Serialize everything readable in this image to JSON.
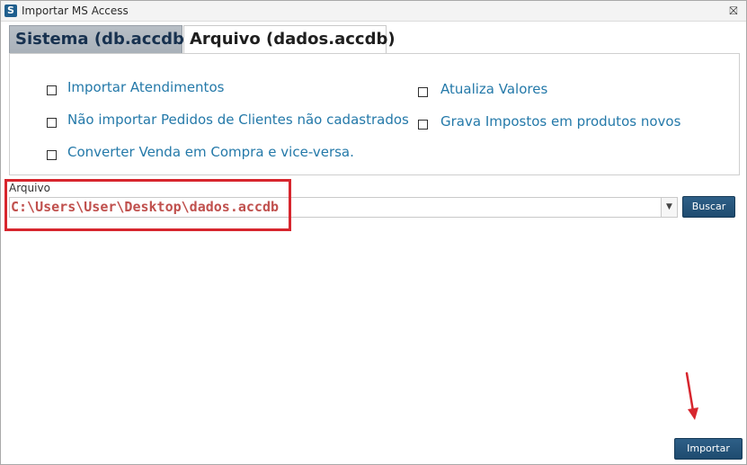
{
  "window": {
    "title": "Importar MS Access",
    "icon": "app-logo-icon",
    "close_icon": "close-icon",
    "close_glyph": "⛝"
  },
  "tabs": [
    {
      "label": "Sistema  (db.accdb)",
      "active": false
    },
    {
      "label": "Arquivo  (dados.accdb)",
      "active": true
    }
  ],
  "options": [
    {
      "label": "Importar Atendimentos",
      "checked": false
    },
    {
      "label": "Não importar Pedidos de Clientes não cadastrados",
      "checked": false
    },
    {
      "label": "Converter Venda em Compra e vice-versa.",
      "checked": false
    },
    {
      "label": "Atualiza Valores",
      "checked": false
    },
    {
      "label": "Grava Impostos em produtos novos",
      "checked": false
    }
  ],
  "file": {
    "label": "Arquivo",
    "value": "C:\\Users\\User\\Desktop\\dados.accdb",
    "dropdown_glyph": "▼"
  },
  "buttons": {
    "buscar": "Buscar",
    "importar": "Importar"
  },
  "colors": {
    "option_text": "#2479a9",
    "button_bg": "#1e4b6f",
    "annotation_red": "#d7262e",
    "file_value_text": "#c0504d"
  }
}
